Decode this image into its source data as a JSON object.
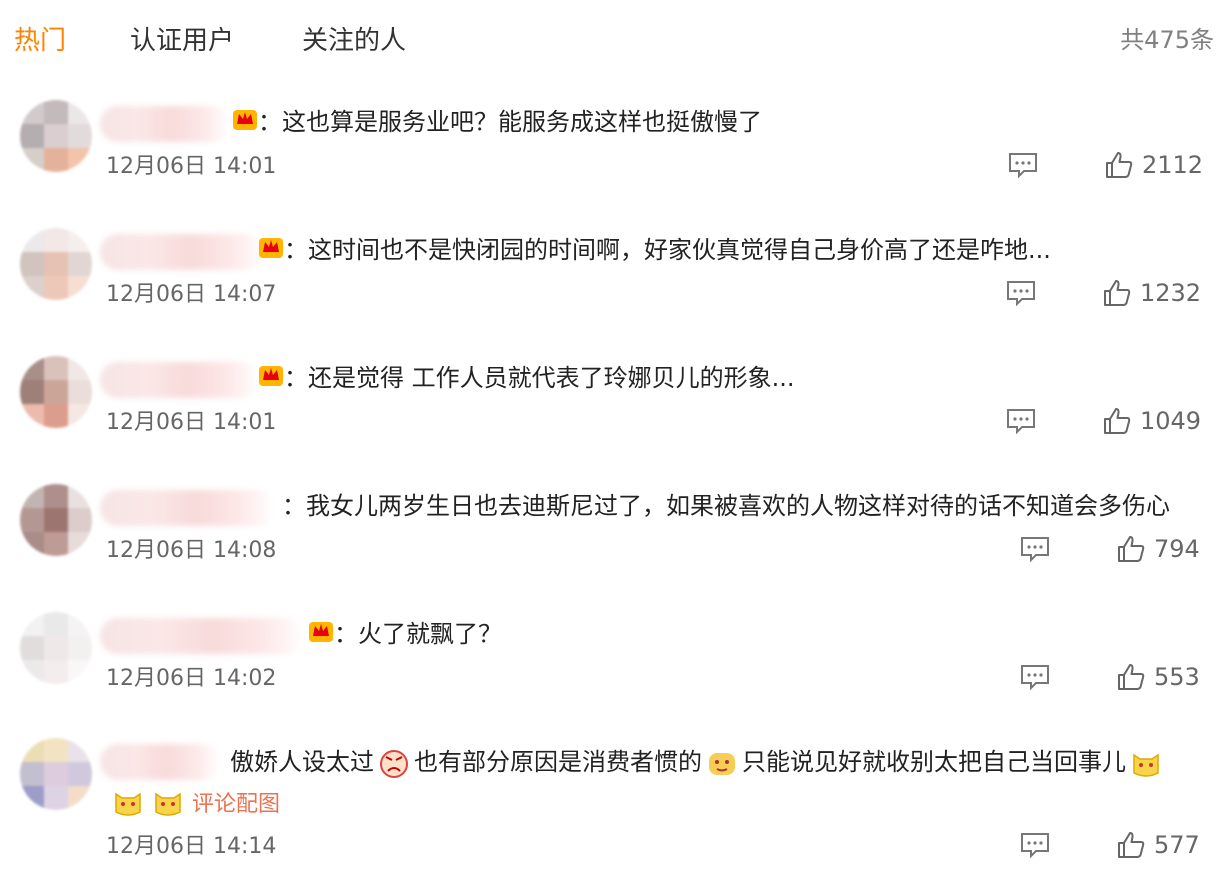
{
  "tabs": [
    {
      "label": "热门"
    },
    {
      "label": "认证用户"
    },
    {
      "label": "关注的人"
    }
  ],
  "total_label": "共475条",
  "colors": {
    "accent": "#ff8200",
    "link": "#eb7350"
  },
  "comments": [
    {
      "text": "：这也算是服务业吧？能服务成这样也挺傲慢了",
      "time": "12月06日 14:01",
      "likes": "2112"
    },
    {
      "text": "：这时间也不是快闭园的时间啊，好家伙真觉得自己身价高了还是咋地...",
      "time": "12月06日 14:07",
      "likes": "1232"
    },
    {
      "text": "：还是觉得 工作人员就代表了玲娜贝儿的形象...",
      "time": "12月06日 14:01",
      "likes": "1049"
    },
    {
      "text": "：我女儿两岁生日也去迪斯尼过了，如果被喜欢的人物这样对待的话不知道会多伤心",
      "time": "12月06日 14:08",
      "likes": "794"
    },
    {
      "text": "：火了就飘了？",
      "time": "12月06日 14:02",
      "likes": "553"
    },
    {
      "text_parts": [
        "傲娇人设太过",
        "也有部分原因是消费者惯的",
        "只能说见好就收别太把自己当回事儿"
      ],
      "view_image_label": "评论配图",
      "time": "12月06日 14:14",
      "likes": "577"
    }
  ],
  "icons": {
    "reply": "comment-icon",
    "like": "thumbs-up-icon",
    "badge": "crown-badge-icon"
  }
}
